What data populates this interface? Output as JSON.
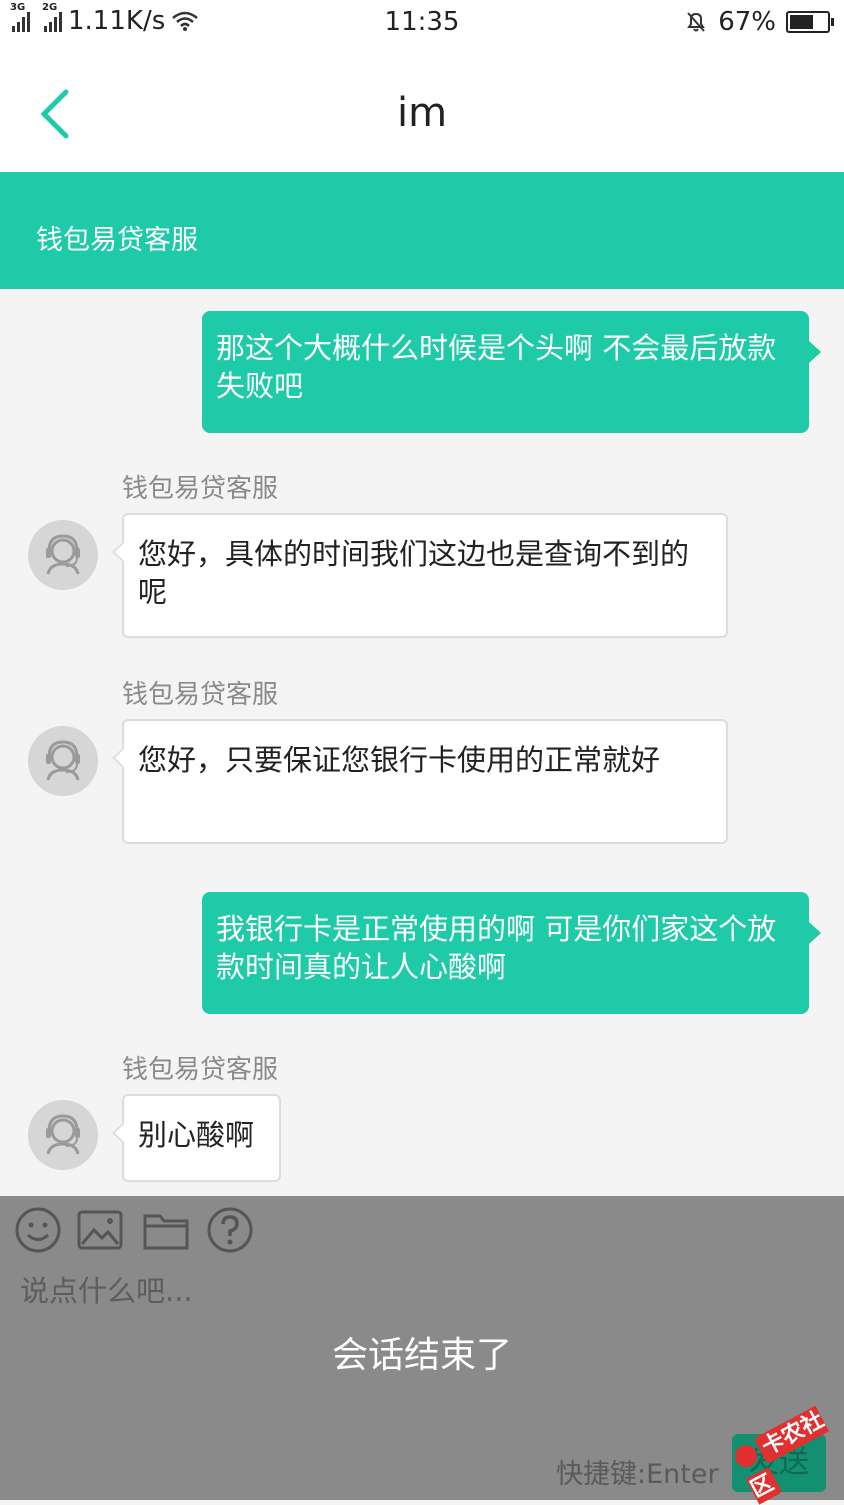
{
  "status_bar": {
    "net1": "3G",
    "net2": "2G",
    "speed": "1.11K/s",
    "time": "11:35",
    "battery": "67%",
    "battery_level": 0.67
  },
  "header": {
    "back_icon": "chevron-left-icon",
    "title": "im"
  },
  "agent_bar": {
    "name": "钱包易贷客服"
  },
  "messages": [
    {
      "side": "right",
      "text": "那这个大概什么时候是个头啊 不会最后放款失败吧"
    },
    {
      "side": "left",
      "sender": "钱包易贷客服",
      "text": "您好，具体的时间我们这边也是查询不到的呢"
    },
    {
      "side": "left",
      "sender": "钱包易贷客服",
      "text": "您好，只要保证您银行卡使用的正常就好"
    },
    {
      "side": "right",
      "text": "我银行卡是正常使用的啊 可是你们家这个放款时间真的让人心酸啊"
    },
    {
      "side": "left",
      "sender": "钱包易贷客服",
      "text": "别心酸啊"
    }
  ],
  "input": {
    "tools": [
      "emoji-icon",
      "image-icon",
      "folder-icon",
      "help-icon"
    ],
    "placeholder": "说点什么吧...",
    "ended_text": "会话结束了",
    "shortcut": "快捷键:Enter",
    "send_label": "发送"
  },
  "watermark": {
    "text": "卡农社区"
  },
  "colors": {
    "accent": "#1ecaa8",
    "overlay": "#8a8a8a"
  }
}
